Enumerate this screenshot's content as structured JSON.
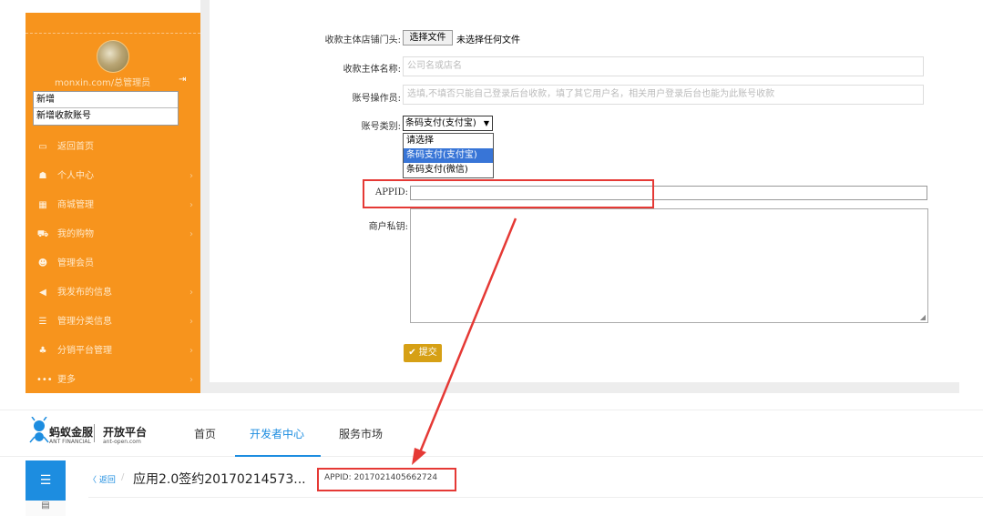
{
  "sidebar": {
    "username": "monxin.com/总管理员",
    "sub_items": [
      "新增",
      "新增收款账号"
    ],
    "menu": [
      {
        "icon": "monitor-icon",
        "glyph": "▭",
        "label": "返回首页",
        "chevron": false
      },
      {
        "icon": "users-icon",
        "glyph": "☗",
        "label": "个人中心",
        "chevron": true
      },
      {
        "icon": "store-icon",
        "glyph": "▦",
        "label": "商城管理",
        "chevron": true
      },
      {
        "icon": "cart-icon",
        "glyph": "⛟",
        "label": "我的购物",
        "chevron": true
      },
      {
        "icon": "user-icon",
        "glyph": "☻",
        "label": "管理会员",
        "chevron": false
      },
      {
        "icon": "megaphone-icon",
        "glyph": "◀",
        "label": "我发布的信息",
        "chevron": true
      },
      {
        "icon": "list-icon",
        "glyph": "☰",
        "label": "管理分类信息",
        "chevron": true
      },
      {
        "icon": "sitemap-icon",
        "glyph": "♣",
        "label": "分销平台管理",
        "chevron": true
      },
      {
        "icon": "more-icon",
        "glyph": "•••",
        "label": "更多",
        "chevron": true
      }
    ]
  },
  "form": {
    "store_header_label": "收款主体店铺门头:",
    "file_button": "选择文件",
    "file_none": "未选择任何文件",
    "name_label": "收款主体名称:",
    "name_placeholder": "公司名或店名",
    "operator_label": "账号操作员:",
    "operator_placeholder": "选填,不填否只能自己登录后台收款，填了其它用户名，相关用户登录后台也能为此账号收款",
    "type_label": "账号类别:",
    "type_selected": "条码支付(支付宝)",
    "type_options": [
      "请选择",
      "条码支付(支付宝)",
      "条码支付(微信)"
    ],
    "appid_label": "APPID:",
    "private_key_label": "商户私钥:",
    "submit": "提交"
  },
  "ant": {
    "logo_text": "蚂蚁金服",
    "logo_sub": "ANT FINANCIAL",
    "open_text": "开放平台",
    "open_sub": "ant-open.com",
    "nav": [
      "首页",
      "开发者中心",
      "服务市场"
    ],
    "back": "返回",
    "app_title": "应用2.0签约20170214573...",
    "appid": "APPID: 2017021405662724"
  },
  "colors": {
    "sidebar": "#f7941d",
    "highlight_red": "#e53935",
    "ant_blue": "#1d8de0",
    "submit_gold": "#d6a015"
  }
}
